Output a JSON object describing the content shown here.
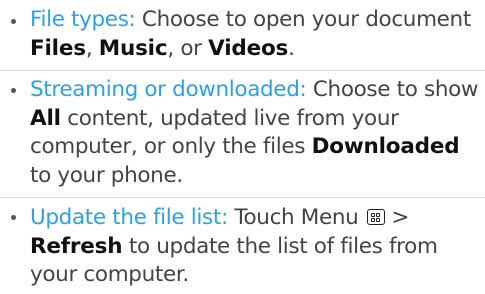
{
  "items": [
    {
      "term": "File types:",
      "p1": " Choose to open your document ",
      "b1": "Files",
      "p2": ", ",
      "b2": "Music",
      "p3": ", or ",
      "b3": "Videos",
      "p4": "."
    },
    {
      "term": "Streaming or downloaded:",
      "p1": " Choose to show ",
      "b1": "All",
      "p2": " content, updated live from your computer, or only the files ",
      "b2": "Downloaded",
      "p3": " to your phone."
    },
    {
      "term": "Update the file list:",
      "p1": " Touch Menu ",
      "icon": "menu-key-icon",
      "p2": " > ",
      "b1": "Refresh",
      "p3": " to update the list of files from your computer."
    }
  ],
  "colors": {
    "term": "#2aa3df",
    "text": "#444444",
    "bold": "#111111",
    "divider": "#dddddd"
  }
}
